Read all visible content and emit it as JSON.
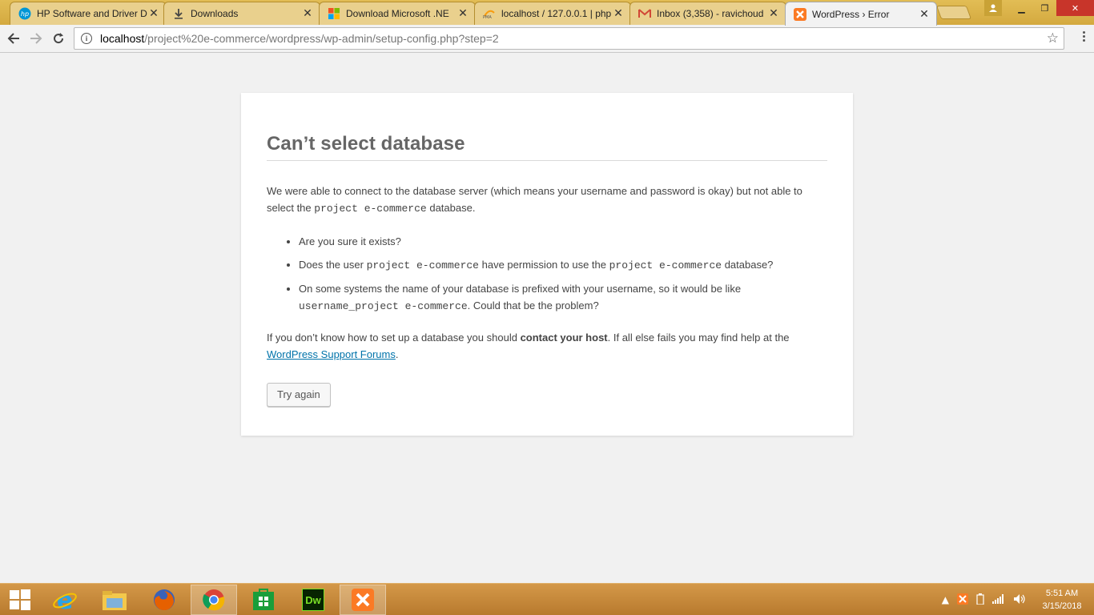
{
  "browser": {
    "tabs": [
      {
        "title": "HP Software and Driver D",
        "icon": "hp-icon"
      },
      {
        "title": "Downloads",
        "icon": "download-icon"
      },
      {
        "title": "Download Microsoft .NE",
        "icon": "microsoft-icon"
      },
      {
        "title": "localhost / 127.0.0.1 | php",
        "icon": "phpmyadmin-icon"
      },
      {
        "title": "Inbox (3,358) - ravichoud",
        "icon": "gmail-icon"
      },
      {
        "title": "WordPress › Error",
        "icon": "xampp-icon"
      }
    ],
    "url_host": "localhost",
    "url_path": "/project%20e-commerce/wordpress/wp-admin/setup-config.php?step=2"
  },
  "page": {
    "heading": "Can’t select database",
    "intro_part1": "We were able to connect to the database server (which means your username and password is okay) but not able to select the",
    "intro_code": "project e-commerce",
    "intro_part2": "database.",
    "bullet1": "Are you sure it exists?",
    "bullet2_part1": "Does the user",
    "bullet2_code1": "project e-commerce",
    "bullet2_part2": "have permission to use the",
    "bullet2_code2": "project e-commerce",
    "bullet2_part3": "database?",
    "bullet3_part1": "On some systems the name of your database is prefixed with your username, so it would be like",
    "bullet3_code": "username_project e-commerce",
    "bullet3_part2": ". Could that be the problem?",
    "help_part1": "If you don’t know how to set up a database you should",
    "help_bold": "contact your host",
    "help_part2": ". If all else fails you may find help at the",
    "help_link": "WordPress Support Forums",
    "help_part3": ".",
    "button": "Try again"
  },
  "taskbar": {
    "apps": [
      "internet-explorer-icon",
      "file-explorer-icon",
      "firefox-icon",
      "chrome-icon",
      "store-icon",
      "dreamweaver-icon",
      "xampp-icon"
    ],
    "dreamweaver_label": "Dw",
    "time": "5:51 AM",
    "date": "3/15/2018"
  }
}
